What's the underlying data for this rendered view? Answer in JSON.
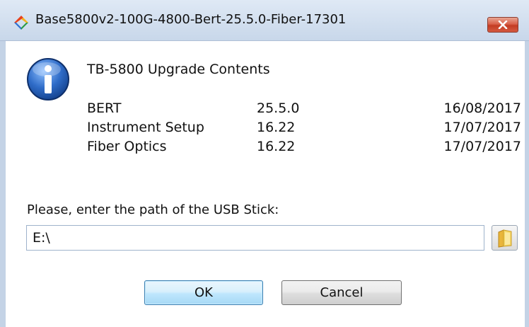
{
  "window": {
    "title": "Base5800v2-100G-4800-Bert-25.5.0-Fiber-17301",
    "close_label": "×",
    "colors": {
      "close": "#c74a2f",
      "titlebar": "#c8d7ea",
      "info": "#2a62b8"
    }
  },
  "dialog": {
    "heading": "TB-5800 Upgrade Contents",
    "rows": [
      {
        "name": "BERT",
        "version": "25.5.0",
        "date": "16/08/2017"
      },
      {
        "name": "Instrument Setup",
        "version": "16.22",
        "date": "17/07/2017"
      },
      {
        "name": "Fiber Optics",
        "version": "16.22",
        "date": "17/07/2017"
      }
    ],
    "prompt": "Please, enter the path of the USB Stick:",
    "path_value": "E:\\",
    "ok_label": "OK",
    "cancel_label": "Cancel"
  },
  "icons": {
    "app": "app-logo-icon",
    "info": "info-icon",
    "browse": "folder-icon",
    "close": "close-icon"
  }
}
